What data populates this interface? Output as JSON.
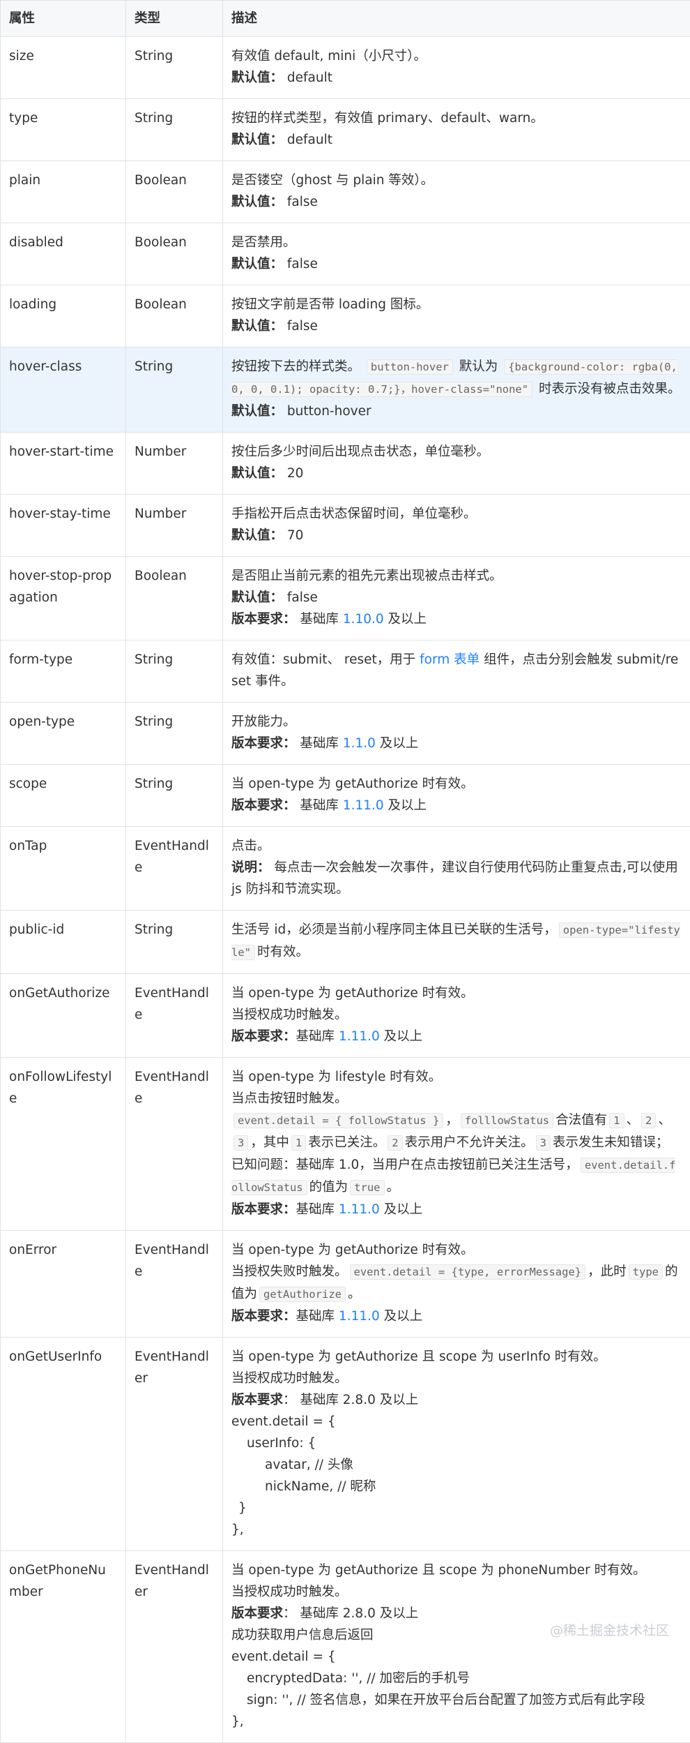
{
  "headers": {
    "attr": "属性",
    "type": "类型",
    "desc": "描述"
  },
  "rows": [
    {
      "attr": "size",
      "type": "String",
      "l1": "有效值 default, mini（小尺寸）。",
      "l2_label": "默认值：",
      "l2_value": "default"
    },
    {
      "attr": "type",
      "type": "String",
      "l1": "按钮的样式类型，有效值 primary、default、warn。",
      "l2_label": "默认值：",
      "l2_value": "default"
    },
    {
      "attr": "plain",
      "type": "Boolean",
      "l1": "是否镂空（ghost 与 plain 等效）。",
      "l2_label": "默认值：",
      "l2_value": "false"
    },
    {
      "attr": "disabled",
      "type": "Boolean",
      "l1": "是否禁用。",
      "l2_label": "默认值：",
      "l2_value": "false"
    },
    {
      "attr": "loading",
      "type": "Boolean",
      "l1": "按钮文字前是否带 loading 图标。",
      "l2_label": "默认值：",
      "l2_value": "false"
    },
    {
      "attr": "hover-class",
      "type": "String",
      "t1": "按钮按下去的样式类。",
      "c1": "button-hover",
      "t2": "默认为",
      "c2": "{background-color: rgba(0, 0, 0, 0.1); opacity: 0.7;}，hover-class=\"none\"",
      "t3": "时表示没有被点击效果。",
      "l2_label": "默认值：",
      "l2_value": "button-hover"
    },
    {
      "attr": "hover-start-time",
      "type": "Number",
      "l1": "按住后多少时间后出现点击状态，单位毫秒。",
      "l2_label": "默认值：",
      "l2_value": "20"
    },
    {
      "attr": "hover-stay-time",
      "type": "Number",
      "l1": "手指松开后点击状态保留时间，单位毫秒。",
      "l2_label": "默认值：",
      "l2_value": "70"
    },
    {
      "attr": "hover-stop-propagation",
      "type": "Boolean",
      "l1": "是否阻止当前元素的祖先元素出现被点击样式。",
      "l2_label": "默认值：",
      "l2_value": "false",
      "l3_label": "版本要求：",
      "l3_pre": "基础库",
      "l3_link": "1.10.0",
      "l3_post": "及以上"
    },
    {
      "attr": "form-type",
      "type": "String",
      "t1": "有效值：submit、 reset，用于",
      "link": "form 表单",
      "t2": "组件，点击分别会触发 submit/reset 事件。"
    },
    {
      "attr": "open-type",
      "type": "String",
      "l1": "开放能力。",
      "l3_label": "版本要求：",
      "l3_pre": "基础库",
      "l3_link": "1.1.0",
      "l3_post": "及以上"
    },
    {
      "attr": "scope",
      "type": "String",
      "l1": "当 open-type 为 getAuthorize 时有效。",
      "l3_label": "版本要求：",
      "l3_pre": "基础库",
      "l3_link": "1.11.0",
      "l3_post": "及以上"
    },
    {
      "attr": "onTap",
      "type": "EventHandle",
      "l1": "点击。",
      "l2_label": "说明：",
      "l2_value": "每点击一次会触发一次事件，建议自行使用代码防止重复点击,可以使用 js 防抖和节流实现。"
    },
    {
      "attr": "public-id",
      "type": "String",
      "t1": "生活号 id，必须是当前小程序同主体且已关联的生活号，",
      "c1": "open-type=\"lifestyle\"",
      "t2": "时有效。"
    },
    {
      "attr": "onGetAuthorize",
      "type": "EventHandle",
      "l1": "当 open-type 为 getAuthorize 时有效。",
      "l2": "当授权成功时触发。",
      "l3_label": "版本要求：",
      "l3_pre": "基础库",
      "l3_link": "1.11.0",
      "l3_post": "及以上"
    },
    {
      "attr": "onFollowLifestyle",
      "type": "EventHandle",
      "l1": "当 open-type 为 lifestyle 时有效。",
      "l2": "当点击按钮时触发。",
      "c1": "event.detail = { followStatus }",
      "t1": "，",
      "c2": "folllowStatus",
      "t2": "合法值有",
      "c3": "1",
      "t3": "、",
      "c4": "2",
      "t4": "、",
      "c5": "3",
      "t5": "，其中",
      "c6": "1",
      "t6": "表示已关注。",
      "c7": "2",
      "t7": "表示用户不允许关注。",
      "c8": "3",
      "t8": "表示发生未知错误；",
      "k1": "已知问题：基础库 1.0，当用户在点击按钮前已关注生活号，",
      "kc": "event.detail.followStatus",
      "k2": "的值为",
      "kc2": "true",
      "k3": "。",
      "l3_label": "版本要求：",
      "l3_pre": "基础库",
      "l3_link": "1.11.0",
      "l3_post": "及以上"
    },
    {
      "attr": "onError",
      "type": "EventHandle",
      "l1": "当 open-type 为 getAuthorize 时有效。",
      "t1": "当授权失败时触发。",
      "c1": "event.detail = {type, errorMessage}",
      "t2": "，此时",
      "c2": "type",
      "t3": "的值为",
      "c3": "getAuthorize",
      "t4": "。",
      "l3_label": "版本要求：",
      "l3_pre": "基础库",
      "l3_link": "1.11.0",
      "l3_post": "及以上"
    },
    {
      "attr": "onGetUserInfo",
      "type": "EventHandler",
      "l1": "当 open-type 为 getAuthorize 且 scope 为 userInfo 时有效。",
      "l2": "当授权成功时触发。",
      "l3_label": "版本要求",
      "l3_rest": "： 基础库  2.8.0 及以上",
      "code": [
        "event.detail = {",
        "userInfo: {",
        "avatar, // 头像",
        "nickName,  // 昵称",
        "}",
        "},"
      ]
    },
    {
      "attr": "onGetPhoneNumber",
      "type": "EventHandler",
      "l1": "当 open-type 为 getAuthorize 且 scope 为 phoneNumber 时有效。",
      "l2": "当授权成功时触发。",
      "l3_label": "版本要求",
      "l3_rest": "： 基础库  2.8.0 及以上",
      "l4": "成功获取用户信息后返回",
      "code": [
        "event.detail = {",
        "encryptedData: '',  // 加密后的手机号",
        "sign: '',  //  签名信息，如果在开放平台后台配置了加签方式后有此字段",
        "},"
      ]
    }
  ],
  "watermark": "@稀土掘金技术社区",
  "colors": {
    "link": "#1e80ff",
    "highlight_row": "#ebf4fd",
    "header_bg": "#f6f8fa",
    "border": "#dfe2e5"
  }
}
